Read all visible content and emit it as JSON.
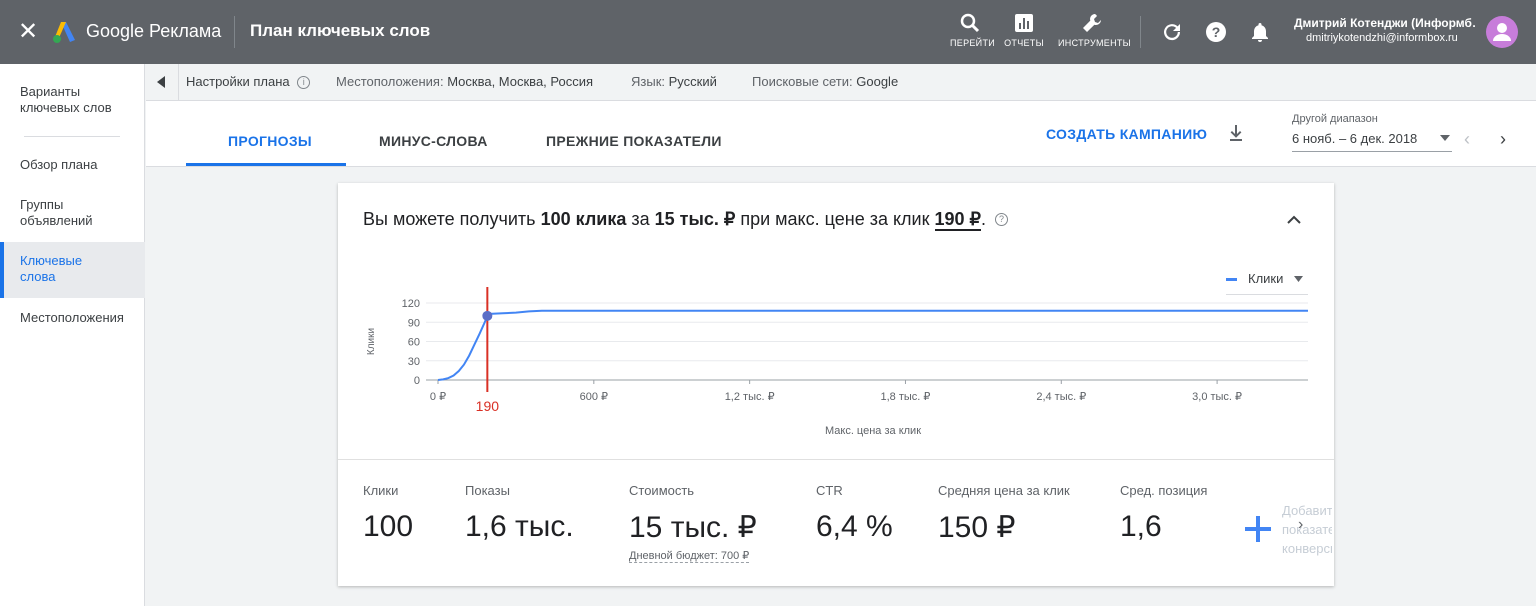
{
  "app": {
    "brand": "Google Реклама",
    "page_title": "План ключевых слов"
  },
  "toolbar": {
    "items": [
      {
        "label": "ПЕРЕЙТИ",
        "icon": "search-icon"
      },
      {
        "label": "ОТЧЕТЫ",
        "icon": "reports-icon"
      },
      {
        "label": "ИНСТРУМЕНТЫ",
        "icon": "tools-icon"
      }
    ]
  },
  "user": {
    "name": "Дмитрий Котенджи (Информб…",
    "email": "dmitriykotendzhi@informbox.ru",
    "avatar_color": "#c77dda"
  },
  "sidebar": {
    "items": [
      {
        "label": "Варианты ключевых слов"
      },
      {
        "label": "Обзор плана"
      },
      {
        "label": "Группы объявлений"
      },
      {
        "label": "Ключевые слова",
        "active": true
      },
      {
        "label": "Местоположения"
      }
    ]
  },
  "settings": {
    "plan": "Настройки плана",
    "location_label": "Местоположения:",
    "location_value": "Москва, Москва, Россия",
    "language_label": "Язык:",
    "language_value": "Русский",
    "network_label": "Поисковые сети:",
    "network_value": "Google"
  },
  "tabs": [
    {
      "label": "ПРОГНОЗЫ",
      "active": true
    },
    {
      "label": "МИНУС-СЛОВА"
    },
    {
      "label": "ПРЕЖНИЕ ПОКАЗАТЕЛИ"
    }
  ],
  "create_campaign": "СОЗДАТЬ КАМПАНИЮ",
  "date_range": {
    "label": "Другой диапазон",
    "value": "6 нояб. – 6 дек. 2018"
  },
  "forecast": {
    "pre": "Вы можете получить",
    "clicks": "100 клика",
    "mid": "за",
    "cost": "15 тыс. ₽",
    "mid2": "при макс. цене за клик",
    "bid": "190 ₽",
    "end": "."
  },
  "chart_data": {
    "type": "line",
    "series": [
      {
        "name": "Клики",
        "x": [
          0,
          20,
          40,
          60,
          80,
          100,
          120,
          140,
          160,
          180,
          190,
          200,
          250,
          300,
          350,
          400,
          600,
          1200,
          1800,
          2400,
          3000,
          3350
        ],
        "y": [
          0,
          1,
          3,
          7,
          14,
          24,
          38,
          55,
          72,
          90,
          100,
          103,
          104,
          105,
          107,
          108,
          108,
          108,
          108,
          108,
          108,
          108
        ]
      }
    ],
    "marker": {
      "x": 190,
      "y": 100,
      "label": "190"
    },
    "xlabel": "Макс. цена за клик",
    "ylabel": "Клики",
    "xlim": [
      0,
      3350
    ],
    "ylim": [
      0,
      120
    ],
    "yticks": [
      "0",
      "30",
      "60",
      "90",
      "120"
    ],
    "xticks": [
      {
        "v": 0,
        "label": "0 ₽"
      },
      {
        "v": 600,
        "label": "600 ₽"
      },
      {
        "v": 1200,
        "label": "1,2 тыс. ₽"
      },
      {
        "v": 1800,
        "label": "1,8 тыс. ₽"
      },
      {
        "v": 2400,
        "label": "2,4 тыс. ₽"
      },
      {
        "v": 3000,
        "label": "3,0 тыс. ₽"
      }
    ],
    "legend": "top-right",
    "grid": true,
    "line_color": "#4285f4",
    "marker_color": "#d93025"
  },
  "legend_label": "Клики",
  "metrics": [
    {
      "label": "Клики",
      "value": "100"
    },
    {
      "label": "Показы",
      "value": "1,6 тыс."
    },
    {
      "label": "Стоимость",
      "value": "15 тыс. ₽",
      "sub": "Дневной бюджет: 700 ₽"
    },
    {
      "label": "CTR",
      "value": "6,4 %"
    },
    {
      "label": "Средняя цена за клик",
      "value": "150 ₽"
    },
    {
      "label": "Сред. позиция",
      "value": "1,6"
    }
  ],
  "add_metric": "Добавить показатель конверсии"
}
